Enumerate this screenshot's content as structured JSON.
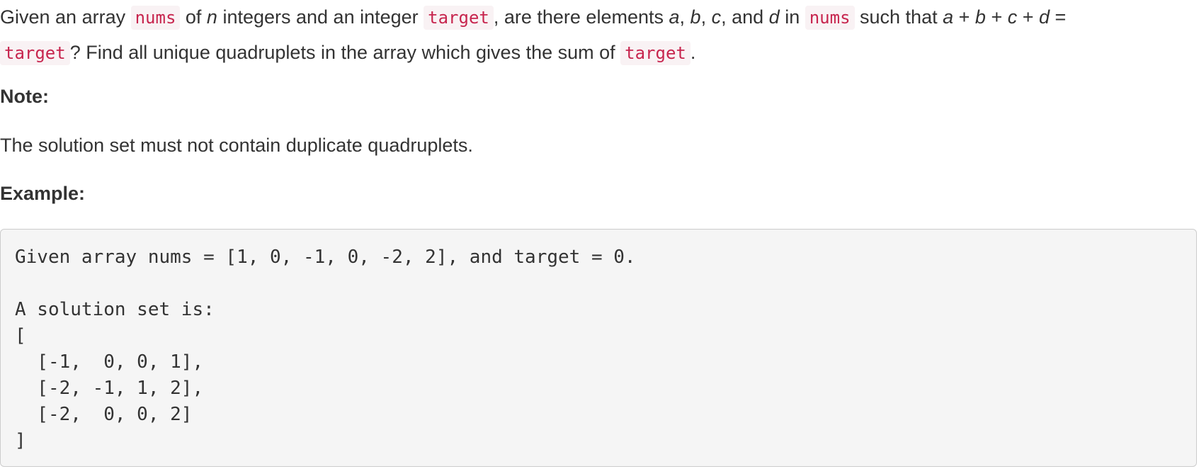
{
  "problem": {
    "t1": "Given an array ",
    "nums1": "nums",
    "t2": " of ",
    "var_n": "n",
    "t3": " integers and an integer ",
    "target1": "target",
    "t4": ", are there elements ",
    "var_a": "a",
    "t5": ", ",
    "var_b": "b",
    "t6": ", ",
    "var_c": "c",
    "t7": ", and ",
    "var_d": "d",
    "t8": " in ",
    "nums2": "nums",
    "t9": " such that ",
    "eq_a": "a",
    "plus1": " + ",
    "eq_b": "b",
    "plus2": " + ",
    "eq_c": "c",
    "plus3": " + ",
    "eq_d": "d",
    "eq_sign": " = ",
    "target2": "target",
    "t10": "? Find all unique quadruplets in the array which gives the sum of ",
    "target3": "target",
    "t11": "."
  },
  "note": {
    "heading": "Note:",
    "text": "The solution set must not contain duplicate quadruplets."
  },
  "example": {
    "heading": "Example:",
    "code": "Given array nums = [1, 0, -1, 0, -2, 2], and target = 0.\n\nA solution set is:\n[\n  [-1,  0, 0, 1],\n  [-2, -1, 1, 2],\n  [-2,  0, 0, 2]\n]"
  }
}
